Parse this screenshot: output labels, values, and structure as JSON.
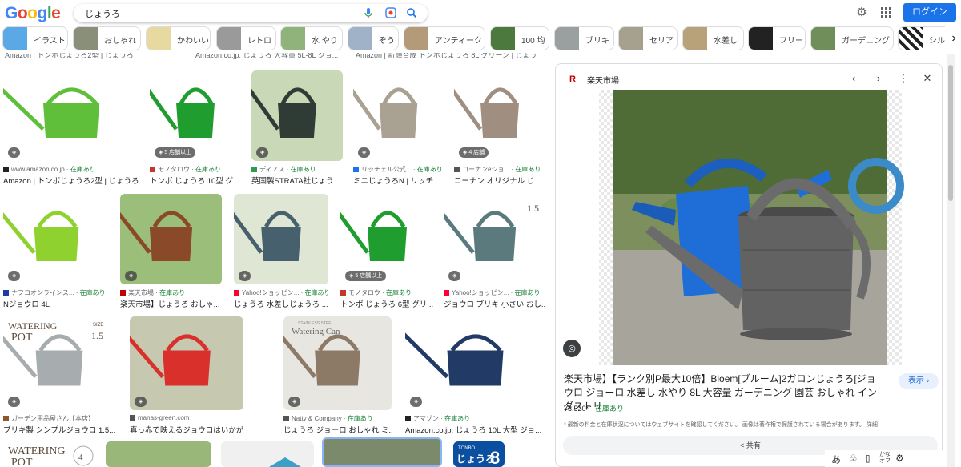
{
  "topbar": {
    "logo": [
      "G",
      "o",
      "o",
      "g",
      "l",
      "e"
    ],
    "logo_colors": [
      "#4285f4",
      "#ea4335",
      "#fbbc05",
      "#4285f4",
      "#34a853",
      "#ea4335"
    ],
    "query": "じょうろ",
    "login": "ログイン"
  },
  "chips": [
    {
      "label": "イラスト",
      "color": "#5aa9e6"
    },
    {
      "label": "おしゃれ",
      "color": "#8a8f7a"
    },
    {
      "label": "かわいい",
      "color": "#e8d9a0"
    },
    {
      "label": "レトロ",
      "color": "#9a9a9a"
    },
    {
      "label": "水 やり",
      "color": "#8fb37a"
    },
    {
      "label": "ぞう",
      "color": "#9fb2c8"
    },
    {
      "label": "アンティーク",
      "color": "#b39a78"
    },
    {
      "label": "100 均",
      "color": "#4c7a3e"
    },
    {
      "label": "ブリキ",
      "color": "#9aa0a0"
    },
    {
      "label": "セリア",
      "color": "#a6a08e"
    },
    {
      "label": "水差し",
      "color": "#b8a27a"
    },
    {
      "label": "フリー",
      "color": "#222222"
    },
    {
      "label": "ガーデニング",
      "color": "#6f8e5a"
    },
    {
      "label": "シルエ",
      "color": "#333333"
    }
  ],
  "top_fragments": [
    "Amazon | トンボじょうろ2型 | じょうろ",
    "Amazon.co.jp: じょうろ 大容量 5L-8L ジョ...",
    "Amazon | 新輝合成 トンボじょうろ 8L グリーン | じょう"
  ],
  "results": [
    {
      "source": "www.amazon.co.jp",
      "stock": "在庫あり",
      "title": "Amazon | トンボじょうろ2型 | じょうろ",
      "badge": "",
      "bg": "#ffffff",
      "can": "#5fbf3a",
      "favicon": "#222222"
    },
    {
      "source": "モノタロウ",
      "stock": "在庫あり",
      "title": "トンボ じょうろ 10型 グ...",
      "badge": "5 店舗以上",
      "bg": "#ffffff",
      "can": "#1f9d2e",
      "favicon": "#c0392b"
    },
    {
      "source": "ディノス",
      "stock": "在庫あり",
      "title": "英国製STRATA社じょう...",
      "badge": "",
      "bg": "#c9d8b6",
      "can": "#2f3b35",
      "favicon": "#2e9b4e"
    },
    {
      "source": "リッチェル公式...",
      "stock": "在庫あり",
      "title": "ミニじょうろN | リッチ...",
      "badge": "",
      "bg": "#ffffff",
      "can": "#a9a191",
      "favicon": "#1a73e8"
    },
    {
      "source": "コーナンeショ...",
      "stock": "在庫あり",
      "title": "コーナン オリジナル じ...",
      "badge": "4 店舗",
      "bg": "#ffffff",
      "can": "#a08f80",
      "favicon": "#555555"
    },
    {
      "source": "ナフコオンラインス...",
      "stock": "在庫あり",
      "title": "Nジョウロ 4L",
      "badge": "",
      "bg": "#ffffff",
      "can": "#8fd12f",
      "favicon": "#1a3fa0"
    },
    {
      "source": "楽天市場",
      "stock": "在庫あり",
      "title": "楽天市場】じょうろ おしゃ...",
      "badge": "",
      "bg": "#9bbf7a",
      "can": "#8a4a2a",
      "favicon": "#bf0000"
    },
    {
      "source": "Yahoo!ショッピン...",
      "stock": "在庫あり",
      "title": "じょうろ 水差しじょうろ ...",
      "badge": "",
      "bg": "#dfe7d4",
      "can": "#46606e",
      "favicon": "#ff0033"
    },
    {
      "source": "モノタロウ",
      "stock": "在庫あり",
      "title": "トンボ じょうろ 6型 グリ...",
      "badge": "5 店舗以上",
      "bg": "#ffffff",
      "can": "#1f9d2e",
      "favicon": "#c0392b"
    },
    {
      "source": "Yahoo!ショッピン...",
      "stock": "在庫あり",
      "title": "ジョウロ ブリキ 小さい おし...",
      "badge": "",
      "bg": "#ffffff",
      "can": "#5b7a7e",
      "favicon": "#ff0033"
    },
    {
      "source": "ガーデン用品屋さん【本店】",
      "stock": "",
      "title": "ブリキ製 シンプルジョウロ 1.5...",
      "badge": "",
      "bg": "#ffffff",
      "can": "#a7acae",
      "favicon": "#8b5a2b"
    },
    {
      "source": "manas-green.com",
      "stock": "",
      "title": "真っ赤で映えるジョウロはいかが？＊Do!...",
      "badge": "",
      "bg": "#c6c9b0",
      "can": "#d9302b",
      "favicon": "#555555"
    },
    {
      "source": "Natty & Company",
      "stock": "在庫あり",
      "title": "じょうろ ジョーロ おしゃれ ミ...",
      "badge": "",
      "bg": "#e8e6e0",
      "can": "#8c7a66",
      "favicon": "#555555"
    },
    {
      "source": "アマゾン",
      "stock": "在庫あり",
      "title": "Amazon.co.jp: じょうろ 10L 大型 ジョ...",
      "badge": "",
      "bg": "#ffffff",
      "can": "#213a66",
      "favicon": "#222222"
    }
  ],
  "labels": {
    "watering_pot": "WATERING",
    "pot": "POT",
    "size": "SIZE",
    "size_val_1": "1.5",
    "size_val_2": "4",
    "watering_can": "Watering Can",
    "stainless": "STAINLESS STEEL",
    "eight": "8",
    "tonbo": "TONBO",
    "jouro": "じょうろ"
  },
  "panel": {
    "site": "楽天市場",
    "title": "楽天市場】【ランク別P最大10倍】Bloem[ブルーム]2ガロンじょうろ[ジョウロ ジョーロ 水差し 水やり 8L 大容量 ガーデニング 園芸 おしゃれ インダストリ...",
    "view": "表示",
    "price": "¥3,520*",
    "stock": "在庫あり",
    "note": "* 最新の料金と在庫状況についてはウェブサイトを確認してください。 画像は著作権で保護されている場合があります。 詳細",
    "share": "共有"
  },
  "ime": {
    "a": "あ",
    "kana": "かな オフ"
  }
}
